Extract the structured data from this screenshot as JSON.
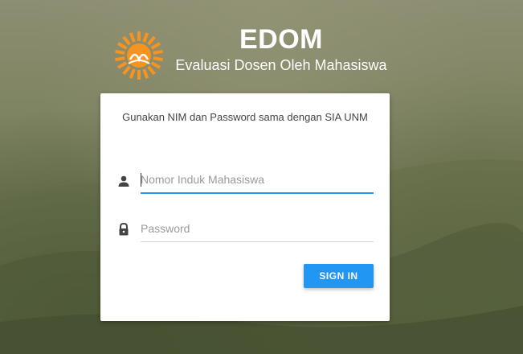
{
  "brand": {
    "title": "EDOM",
    "subtitle": "Evaluasi Dosen Oleh Mahasiswa",
    "logo_color": "#f7931e"
  },
  "login": {
    "message": "Gunakan NIM dan Password sama dengan SIA UNM",
    "nim": {
      "placeholder": "Nomor Induk Mahasiswa",
      "value": "",
      "icon": "person-icon"
    },
    "password": {
      "placeholder": "Password",
      "value": "",
      "icon": "lock-icon"
    },
    "submit_label": "SIGN IN",
    "accent": "#2196f3"
  }
}
